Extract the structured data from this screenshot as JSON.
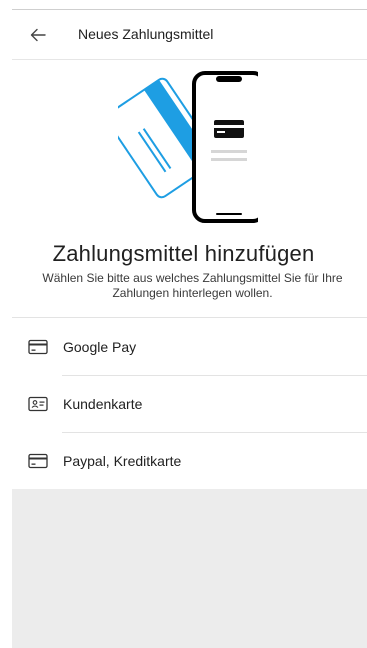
{
  "app_bar": {
    "title": "Neues Zahlungsmittel",
    "back_icon": "arrow-left-icon"
  },
  "content": {
    "headline": "Zahlungsmittel hinzufügen",
    "subtext": "Wählen Sie bitte aus welches Zahlungsmittel Sie für Ihre Zahlungen hinterlegen wollen."
  },
  "colors": {
    "accent": "#1e9ee3",
    "text": "#212121",
    "divider": "#e3e3e3",
    "bottom_area": "#ececec"
  },
  "payment_options": [
    {
      "label": "Google Pay",
      "icon": "credit-card-icon"
    },
    {
      "label": "Kundenkarte",
      "icon": "customer-card-icon"
    },
    {
      "label": "Paypal, Kreditkarte",
      "icon": "credit-card-icon"
    }
  ]
}
